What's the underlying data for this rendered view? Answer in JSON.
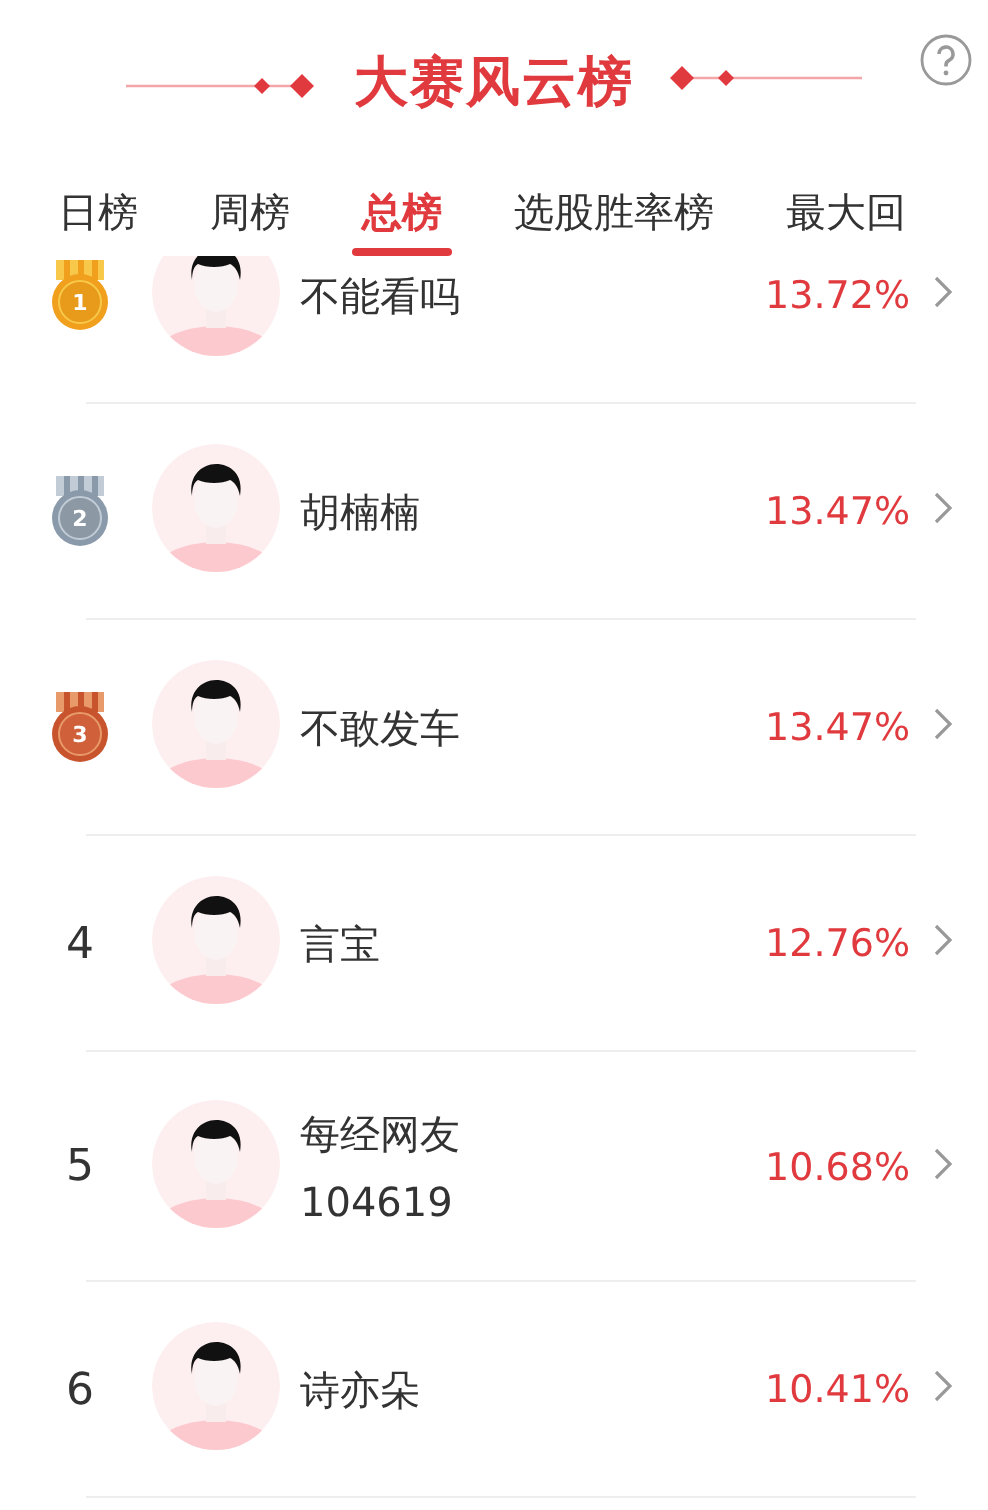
{
  "header": {
    "title": "大赛风云榜"
  },
  "tabs": [
    {
      "label": "日榜",
      "selected": false
    },
    {
      "label": "周榜",
      "selected": false
    },
    {
      "label": "总榜",
      "selected": true
    },
    {
      "label": "选股胜率榜",
      "selected": false
    },
    {
      "label": "最大回",
      "selected": false
    }
  ],
  "rows": [
    {
      "rank": "1",
      "kind": "gold",
      "name": "不能看吗",
      "rate": "13.72%"
    },
    {
      "rank": "2",
      "kind": "silver",
      "name": "胡楠楠",
      "rate": "13.47%"
    },
    {
      "rank": "3",
      "kind": "bronze",
      "name": "不敢发车",
      "rate": "13.47%"
    },
    {
      "rank": "4",
      "kind": "plain",
      "name": "言宝",
      "rate": "12.76%"
    },
    {
      "rank": "5",
      "kind": "plain",
      "name": "每经网友",
      "sub": "104619",
      "rate": "10.68%"
    },
    {
      "rank": "6",
      "kind": "plain",
      "name": "诗亦朵",
      "rate": "10.41%"
    }
  ]
}
